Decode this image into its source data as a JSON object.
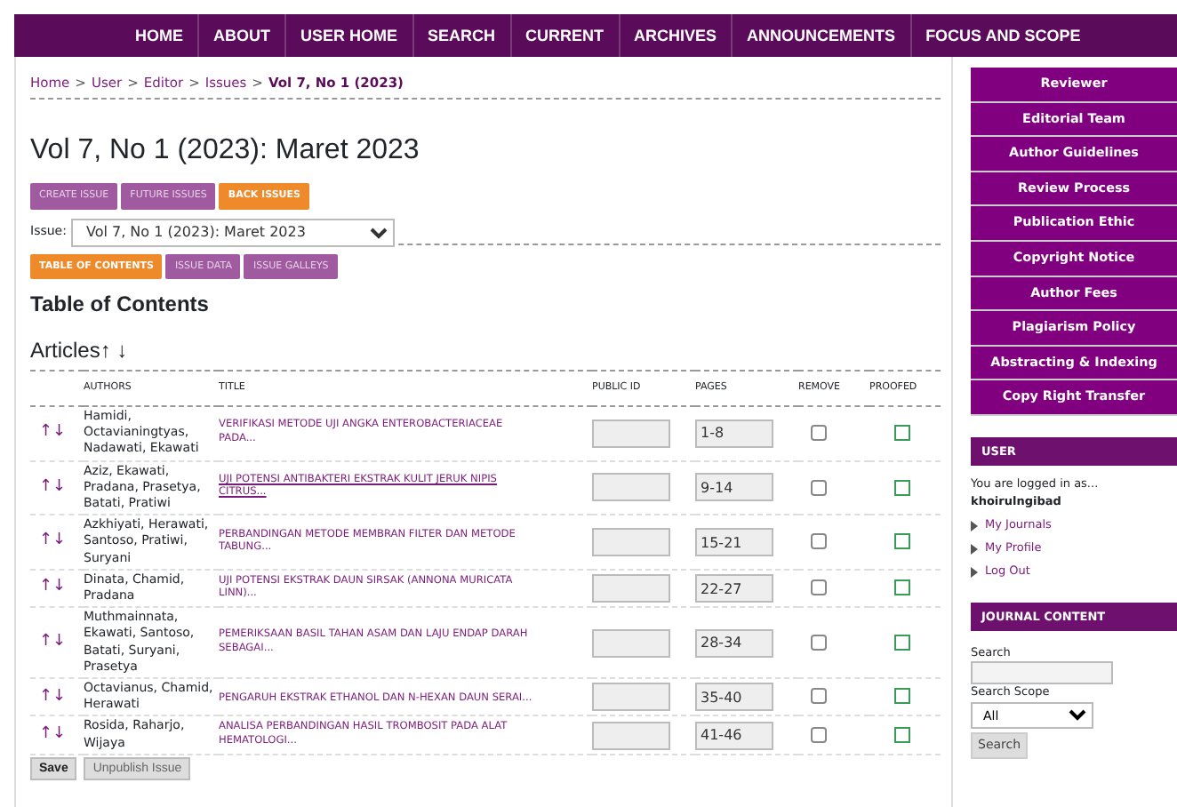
{
  "nav": [
    {
      "label": "HOME"
    },
    {
      "label": "ABOUT"
    },
    {
      "label": "USER HOME"
    },
    {
      "label": "SEARCH"
    },
    {
      "label": "CURRENT"
    },
    {
      "label": "ARCHIVES"
    },
    {
      "label": "ANNOUNCEMENTS"
    },
    {
      "label": "FOCUS AND SCOPE"
    }
  ],
  "breadcrumb": [
    {
      "label": "Home",
      "current": false
    },
    {
      "label": "User",
      "current": false
    },
    {
      "label": "Editor",
      "current": false
    },
    {
      "label": "Issues",
      "current": false
    },
    {
      "label": "Vol 7, No 1 (2023)",
      "current": true
    }
  ],
  "breadcrumb_separator": ">",
  "heading": "Vol 7, No 1 (2023): Maret 2023",
  "issue_menu": [
    {
      "label": "CREATE ISSUE",
      "selected": false
    },
    {
      "label": "FUTURE ISSUES",
      "selected": false
    },
    {
      "label": "BACK ISSUES",
      "selected": true
    }
  ],
  "issue_select": {
    "label": "Issue:",
    "value": "Vol 7, No 1 (2023): Maret 2023"
  },
  "tabs": [
    {
      "label": "TABLE OF CONTENTS",
      "selected": true
    },
    {
      "label": "ISSUE DATA",
      "selected": false
    },
    {
      "label": "ISSUE GALLEYS",
      "selected": false
    }
  ],
  "toc_heading": "Table of Contents",
  "section_heading": "Articles↑ ↓",
  "table": {
    "columns": [
      "AUTHORS",
      "TITLE",
      "PUBLIC ID",
      "PAGES",
      "REMOVE",
      "PROOFED"
    ],
    "rows": [
      {
        "move": "↑↓",
        "authors": "Hamidi, Octavianingtyas, Nadawati, Ekawati",
        "title": "VERIFIKASI METODE UJI ANGKA ENTEROBACTERIACEAE PADA...",
        "hovered": false,
        "pages": "1-8",
        "remove": false,
        "proofed": false
      },
      {
        "move": "↑↓",
        "authors": "Aziz, Ekawati, Pradana, Prasetya, Batati, Pratiwi",
        "title": "UJI POTENSI ANTIBAKTERI EKSTRAK KULIT JERUK NIPIS CITRUS...",
        "hovered": true,
        "pages": "9-14",
        "remove": false,
        "proofed": false
      },
      {
        "move": "↑↓",
        "authors": "Azkhiyati, Herawati, Santoso, Pratiwi, Suryani",
        "title": "PERBANDINGAN METODE MEMBRAN FILTER DAN METODE TABUNG...",
        "hovered": false,
        "pages": "15-21",
        "remove": false,
        "proofed": false
      },
      {
        "move": "↑↓",
        "authors": "Dinata, Chamid, Pradana",
        "title": "UJI POTENSI EKSTRAK DAUN SIRSAK (ANNONA MURICATA LINN)...",
        "hovered": false,
        "pages": "22-27",
        "remove": false,
        "proofed": false
      },
      {
        "move": "↑↓",
        "authors": "Muthmainnata, Ekawati, Santoso, Batati, Suryani, Prasetya",
        "title": "PEMERIKSAAN BASIL TAHAN ASAM DAN LAJU ENDAP DARAH SEBAGAI...",
        "hovered": false,
        "pages": "28-34",
        "remove": false,
        "proofed": false
      },
      {
        "move": "↑↓",
        "authors": "Octavianus, Chamid, Herawati",
        "title": "PENGARUH EKSTRAK ETHANOL DAN N-HEXAN DAUN SERAI...",
        "hovered": false,
        "pages": "35-40",
        "remove": false,
        "proofed": false
      },
      {
        "move": "↑↓",
        "authors": "Rosida, Raharjo, Wijaya",
        "title": "ANALISA PERBANDINGAN HASIL TROMBOSIT PADA ALAT HEMATOLOGI...",
        "hovered": false,
        "pages": "41-46",
        "remove": false,
        "proofed": false
      }
    ]
  },
  "buttons": [
    "Save",
    "Unpublish Issue"
  ],
  "sidebar": {
    "links": [
      "Reviewer",
      "Editorial Team",
      "Author Guidelines",
      "Review Process",
      "Publication Ethic",
      "Copyright Notice",
      "Author Fees",
      "Plagiarism Policy",
      "Abstracting & Indexing",
      "Copy Right Transfer"
    ],
    "user": {
      "title": "USER",
      "logged_in_text": "You are logged in as...",
      "username": "khoirulngibad",
      "links": [
        "My Journals",
        "My Profile",
        "Log Out"
      ]
    },
    "journal_content": {
      "title": "JOURNAL CONTENT",
      "search_label": "Search",
      "scope_label": "Search Scope",
      "scope_value": "All",
      "search_button": "Search"
    }
  }
}
